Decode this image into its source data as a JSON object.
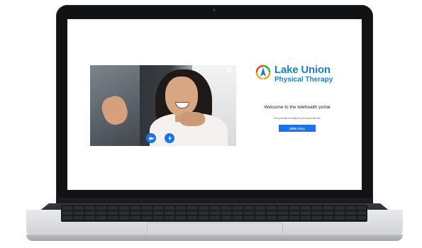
{
  "portal": {
    "logo": {
      "name_line1": "Lake Union",
      "name_line2": "Physical Therapy",
      "brand_color": "#1d7fc4"
    },
    "welcome_text": "Welcome to the telehealth portal",
    "provider_status": "Your provider is ready for you to join the call.",
    "join_button_label": "JOIN CALL",
    "accent_color": "#1a73e8"
  },
  "video": {
    "controls": [
      {
        "icon": "video-camera-icon"
      },
      {
        "icon": "microphone-icon"
      }
    ],
    "settings_icon": "gear-icon"
  }
}
